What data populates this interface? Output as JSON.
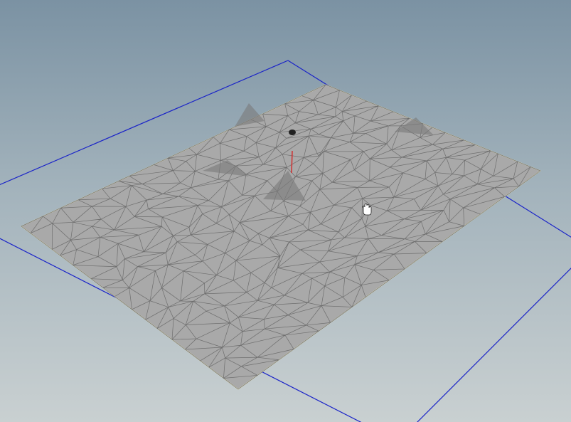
{
  "viewport": {
    "background_top": "#7b92a3",
    "background_bottom": "#c9d0d1",
    "ground_plane_color": "#1a23c8",
    "terrain_fill": "#a9a9a9",
    "terrain_wire": "#6e6e6e",
    "terrain_border": "#e8e2b8",
    "handle_color": "#d03030"
  }
}
